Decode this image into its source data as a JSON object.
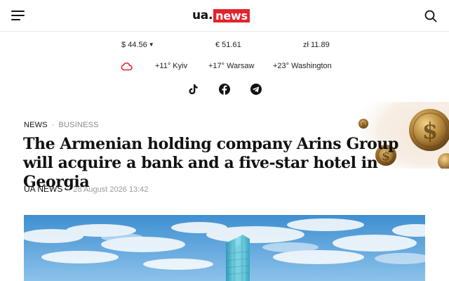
{
  "header": {
    "logo_left": "ua.",
    "logo_right": "news"
  },
  "rates": {
    "usd": "$ 44.56",
    "eur": "€ 51.61",
    "pln": "zł 11.89"
  },
  "weather": {
    "kyiv": "+11° Kyiv",
    "warsaw": "+17° Warsaw",
    "washington": "+23° Washington"
  },
  "social": [
    "tiktok-icon",
    "facebook-icon",
    "telegram-icon"
  ],
  "article": {
    "category": "NEWS",
    "subcategory": "BUSINESS",
    "title": "The Armenian holding company Arins Group will acquire a bank and a five-star hotel in Georgia",
    "source": "UA NEWS",
    "date": "28 August 2026 13:42"
  },
  "colors": {
    "brand_red": "#e4232b",
    "weather_icon": "#e4232b",
    "text": "#111111",
    "muted": "#999999"
  }
}
